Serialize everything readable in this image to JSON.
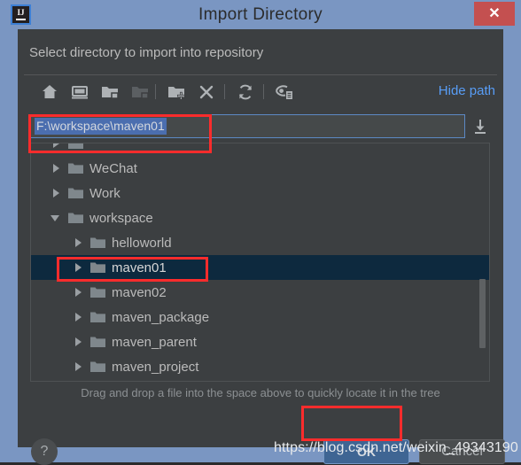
{
  "window": {
    "title": "Import Directory",
    "logo_text": "IJ",
    "close_label": "✕",
    "frame_color": "#7a96c2",
    "content_bg": "#3c3f41",
    "close_color": "#c45050"
  },
  "dialog": {
    "prompt": "Select directory to import into repository",
    "hint": "Drag and drop a file into the space above to quickly locate it in the tree"
  },
  "toolbar": {
    "hide_path_label": "Hide path",
    "hide_path_color": "#589df6",
    "icons": [
      {
        "name": "home-icon",
        "title": "Home"
      },
      {
        "name": "desktop-icon",
        "title": "Desktop"
      },
      {
        "name": "project-folder-icon",
        "title": "Project Directory"
      },
      {
        "name": "module-folder-icon",
        "title": "Module Directory"
      },
      {
        "name": "new-folder-icon",
        "title": "New Folder"
      },
      {
        "name": "delete-icon",
        "title": "Delete"
      },
      {
        "name": "refresh-icon",
        "title": "Refresh"
      },
      {
        "name": "show-hidden-icon",
        "title": "Show Hidden Files"
      }
    ]
  },
  "path_field": {
    "value": "F:\\workspace\\maven01",
    "selected": true,
    "selection_color": "#4b6eaf",
    "download_icon": "insert-path-icon"
  },
  "tree": {
    "nodes": [
      {
        "label": "",
        "indent": 0,
        "state": "partial",
        "selected": false,
        "cut": true
      },
      {
        "label": "WeChat",
        "indent": 0,
        "state": "collapsed",
        "selected": false
      },
      {
        "label": "Work",
        "indent": 0,
        "state": "collapsed",
        "selected": false
      },
      {
        "label": "workspace",
        "indent": 0,
        "state": "expanded",
        "selected": false
      },
      {
        "label": "helloworld",
        "indent": 1,
        "state": "collapsed",
        "selected": false
      },
      {
        "label": "maven01",
        "indent": 1,
        "state": "collapsed",
        "selected": true
      },
      {
        "label": "maven02",
        "indent": 1,
        "state": "collapsed",
        "selected": false
      },
      {
        "label": "maven_package",
        "indent": 1,
        "state": "collapsed",
        "selected": false
      },
      {
        "label": "maven_parent",
        "indent": 1,
        "state": "collapsed",
        "selected": false
      },
      {
        "label": "maven_project",
        "indent": 1,
        "state": "collapsed",
        "selected": false
      }
    ],
    "selection_color": "#0d293e"
  },
  "footer": {
    "help_label": "?",
    "ok_label": "OK",
    "cancel_label": "Cancel",
    "ok_color": "#3f6593"
  },
  "annotations": {
    "color": "#fc2c2c",
    "boxes": [
      "path-field-highlight",
      "selected-node-highlight",
      "ok-button-highlight"
    ]
  },
  "watermark": {
    "text": "https://blog.csdn.net/weixin_49343190"
  }
}
